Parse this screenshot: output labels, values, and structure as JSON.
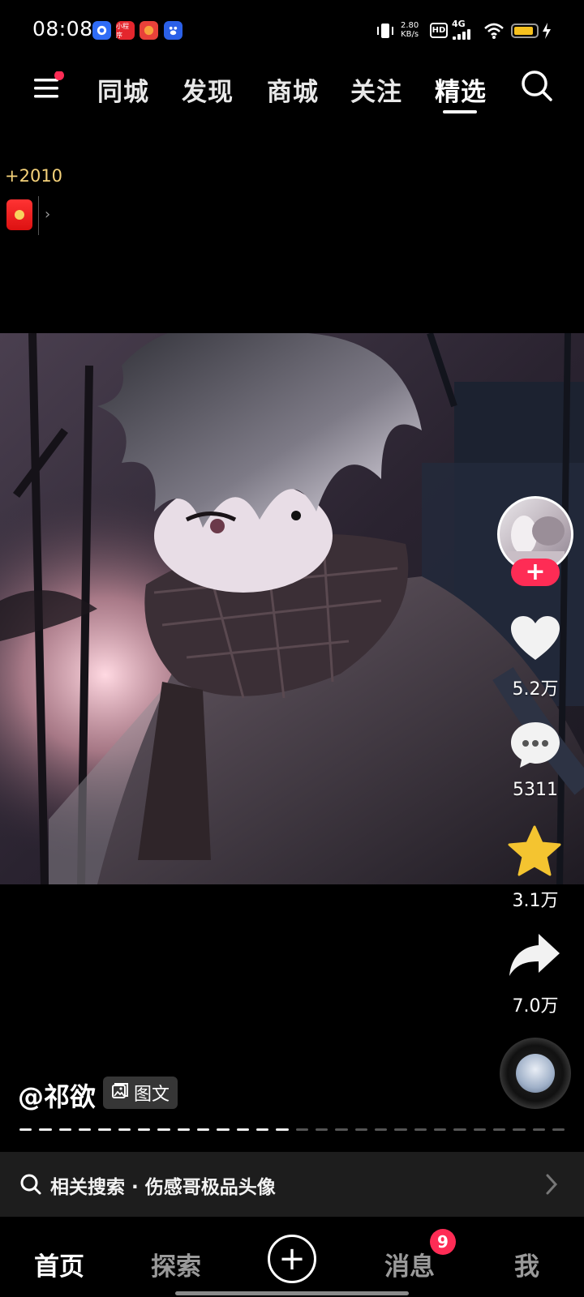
{
  "status_bar": {
    "time": "08:08",
    "app_icons": [
      {
        "name": "baidu-map-icon",
        "color": "#2f6cf6"
      },
      {
        "name": "mini-app-icon",
        "color": "#e4262d",
        "text": "小程序"
      },
      {
        "name": "red-app-icon",
        "color": "#e8413a"
      },
      {
        "name": "baidu-icon",
        "color": "#2b60e8"
      }
    ],
    "data_rate_value": "2.80",
    "data_rate_unit": "KB/s",
    "hd_label": "HD",
    "network_label": "4G",
    "battery_level": 0.88,
    "battery_color": "#f6c11f"
  },
  "top_nav": {
    "tabs": [
      {
        "label": "同城"
      },
      {
        "label": "发现"
      },
      {
        "label": "商城"
      },
      {
        "label": "关注"
      },
      {
        "label": "精选",
        "active": true
      }
    ]
  },
  "reward": {
    "points": "+2010"
  },
  "actions": {
    "likes": "5.2万",
    "comments": "5311",
    "favorites": "3.1万",
    "shares": "7.0万"
  },
  "post": {
    "author": "@祁欲",
    "type_label": "图文",
    "image_count": 28,
    "current_index": 14
  },
  "related_search": {
    "text": "相关搜索 · 伤感哥极品头像"
  },
  "bottom_nav": {
    "items": [
      {
        "label": "首页",
        "active": true
      },
      {
        "label": "探索"
      },
      {
        "label": "消息"
      },
      {
        "label": "我"
      }
    ],
    "message_badge": "9"
  },
  "colors": {
    "accent": "#fe2c55",
    "favorite_star": "#f4c430",
    "reward_text": "#f5d27a"
  }
}
